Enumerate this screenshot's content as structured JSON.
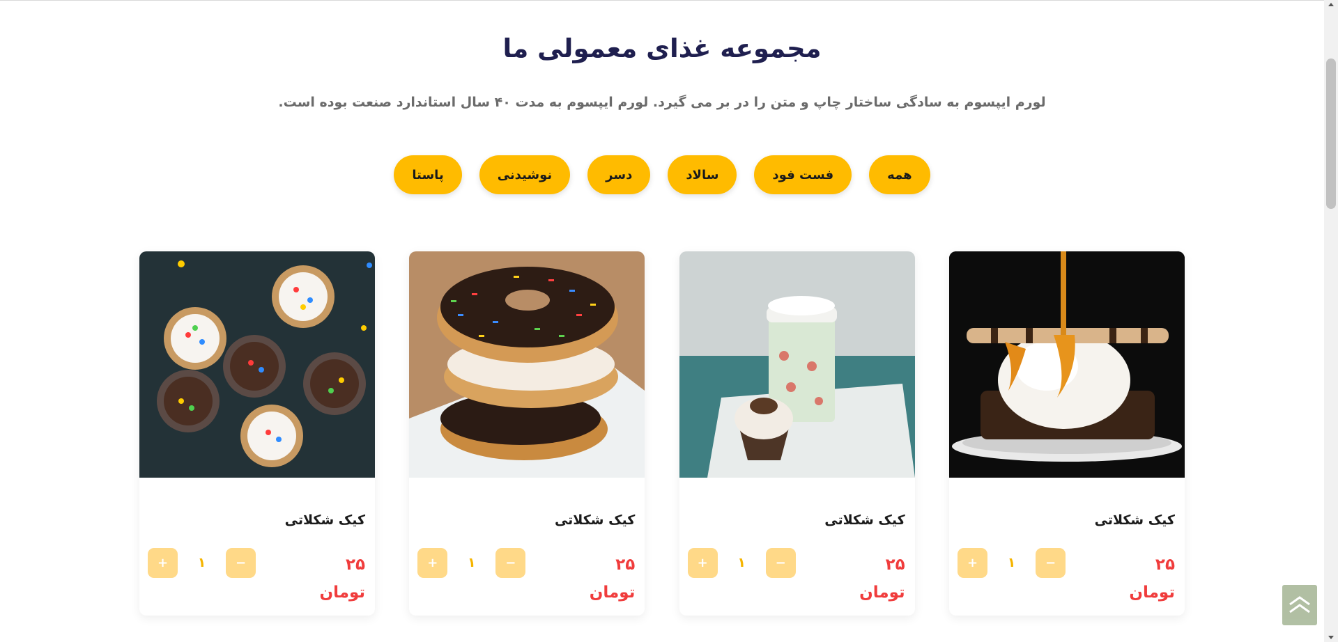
{
  "section": {
    "title": "مجموعه غذای معمولی ما",
    "subtitle": "لورم ایپسوم به سادگی ساختار چاپ و متن را در بر می گیرد. لورم ایپسوم به مدت ۴۰ سال استاندارد صنعت بوده است."
  },
  "filters": [
    {
      "label": "همه"
    },
    {
      "label": "فست فود"
    },
    {
      "label": "سالاد"
    },
    {
      "label": "دسر"
    },
    {
      "label": "نوشیدنی"
    },
    {
      "label": "پاستا"
    }
  ],
  "products": [
    {
      "name": "کیک شکلاتی",
      "price": "۲۵",
      "currency": "تومان",
      "qty": "۱",
      "plus": "+",
      "minus": "−",
      "image": "ice-cream-brownie"
    },
    {
      "name": "کیک شکلاتی",
      "price": "۲۵",
      "currency": "تومان",
      "qty": "۱",
      "plus": "+",
      "minus": "−",
      "image": "cupcake-coffee"
    },
    {
      "name": "کیک شکلاتی",
      "price": "۲۵",
      "currency": "تومان",
      "qty": "۱",
      "plus": "+",
      "minus": "−",
      "image": "donut-stack"
    },
    {
      "name": "کیک شکلاتی",
      "price": "۲۵",
      "currency": "تومان",
      "qty": "۱",
      "plus": "+",
      "minus": "−",
      "image": "cupcakes-top"
    }
  ],
  "colors": {
    "accent": "#ffbb00",
    "qty_button": "#ffd988",
    "price": "#f03c3c",
    "title": "#1f1f4f",
    "scroll_top": "#a9b99a"
  },
  "icons": {
    "scroll_top": "double-chevron-up-icon"
  }
}
